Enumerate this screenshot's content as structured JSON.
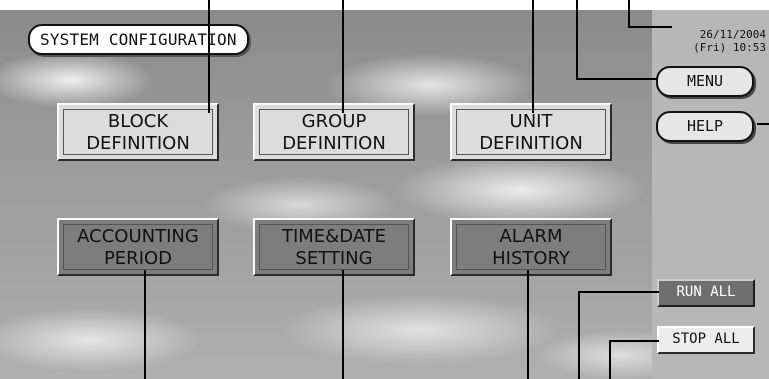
{
  "screen": {
    "title": "SYSTEM CONFIGURATION",
    "datetime_date": "26/11/2004",
    "datetime_time": "(Fri) 10:53"
  },
  "buttons": {
    "block_definition": [
      "BLOCK",
      "DEFINITION"
    ],
    "group_definition": [
      "GROUP",
      "DEFINITION"
    ],
    "unit_definition": [
      "UNIT",
      "DEFINITION"
    ],
    "accounting_period": [
      "ACCOUNTING",
      "PERIOD"
    ],
    "time_date_setting": [
      "TIME&DATE",
      "SETTING"
    ],
    "alarm_history": [
      "ALARM",
      "HISTORY"
    ]
  },
  "side": {
    "menu": "MENU",
    "help": "HELP",
    "run_all": "RUN ALL",
    "stop_all": "STOP ALL"
  },
  "colors": {
    "panel_gray": "#b7b7b7",
    "button_light": "#dcdcdc",
    "button_dark": "#7d7d7d",
    "run_all_bg": "#6f6f6f"
  }
}
